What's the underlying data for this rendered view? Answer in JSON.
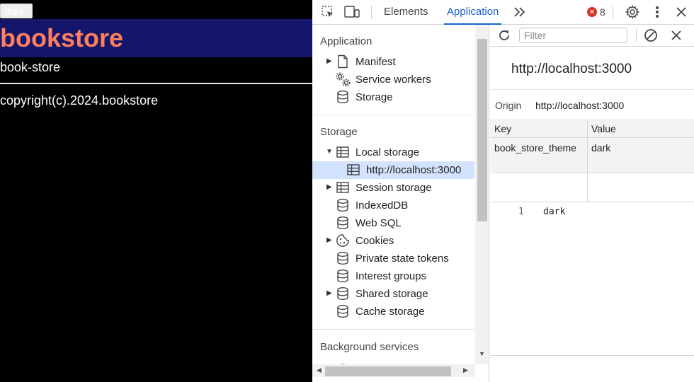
{
  "page": {
    "theme_button_label": "dark",
    "site_title": "bookstore",
    "nav_text": "book-store",
    "footer_text": "copyright(c).2024.bookstore"
  },
  "devtools": {
    "tabs": [
      {
        "label": "Elements"
      },
      {
        "label": "Application"
      }
    ],
    "more_tabs_icon": "chevron-double-right",
    "error_count": "8",
    "sidebar": {
      "sections": [
        {
          "heading": "Application",
          "items": [
            {
              "label": "Manifest",
              "icon": "document-icon",
              "expandable": true
            },
            {
              "label": "Service workers",
              "icon": "gears-icon",
              "expandable": false
            },
            {
              "label": "Storage",
              "icon": "database-icon",
              "expandable": false
            }
          ]
        },
        {
          "heading": "Storage",
          "items": [
            {
              "label": "Local storage",
              "icon": "table-icon",
              "expandable": true,
              "expanded": true
            },
            {
              "label": "http://localhost:3000",
              "icon": "table-icon",
              "selected": true,
              "child": true
            },
            {
              "label": "Session storage",
              "icon": "table-icon",
              "expandable": true
            },
            {
              "label": "IndexedDB",
              "icon": "database-icon"
            },
            {
              "label": "Web SQL",
              "icon": "database-icon"
            },
            {
              "label": "Cookies",
              "icon": "cookie-icon",
              "expandable": true
            },
            {
              "label": "Private state tokens",
              "icon": "database-icon"
            },
            {
              "label": "Interest groups",
              "icon": "database-icon"
            },
            {
              "label": "Shared storage",
              "icon": "database-icon",
              "expandable": true
            },
            {
              "label": "Cache storage",
              "icon": "database-icon"
            }
          ]
        },
        {
          "heading": "Background services",
          "items": []
        }
      ]
    },
    "main": {
      "filter_placeholder": "Filter",
      "origin_title": "http://localhost:3000",
      "origin_label": "Origin",
      "origin_value": "http://localhost:3000",
      "table": {
        "columns": [
          "Key",
          "Value"
        ],
        "rows": [
          {
            "key": "book_store_theme",
            "value": "dark"
          }
        ]
      },
      "preview": {
        "line_number": "1",
        "content": "dark"
      }
    }
  }
}
